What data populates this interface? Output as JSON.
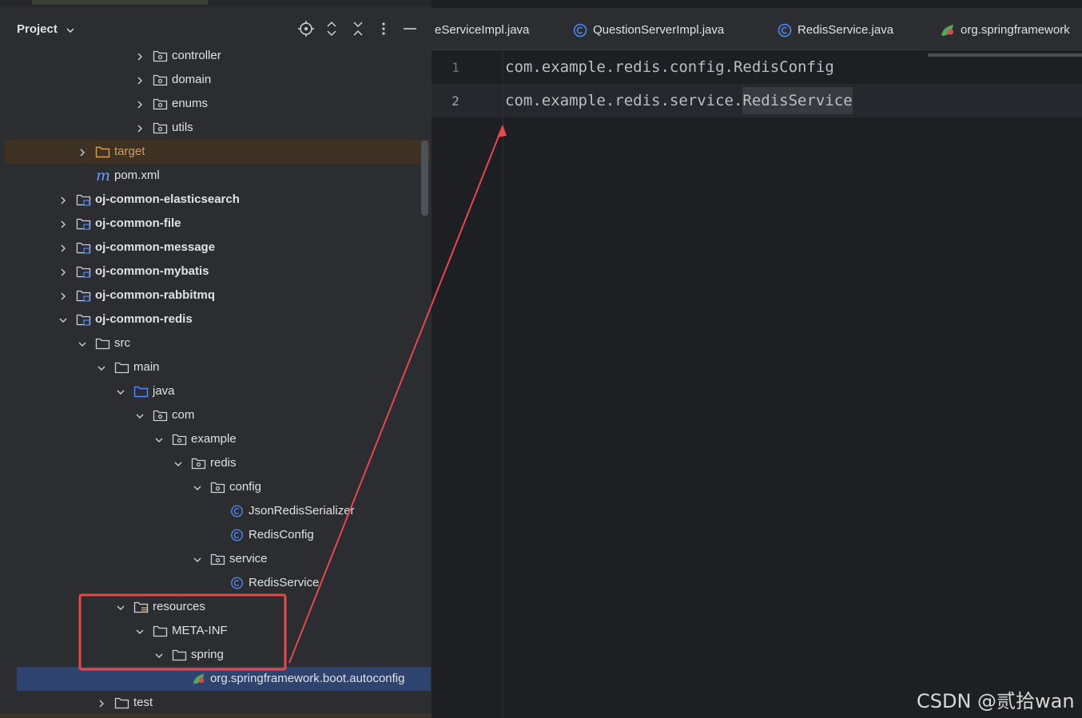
{
  "project_panel": {
    "title": "Project",
    "header_icons": [
      "locate-icon",
      "expand-collapse-icon",
      "collapse-all-icon",
      "more-options-icon",
      "minimize-icon"
    ]
  },
  "tree": [
    {
      "label": "controller",
      "depth": 4,
      "expanded": false,
      "icon": "package-folder-icon"
    },
    {
      "label": "domain",
      "depth": 4,
      "expanded": false,
      "icon": "package-folder-icon"
    },
    {
      "label": "enums",
      "depth": 4,
      "expanded": false,
      "icon": "package-folder-icon"
    },
    {
      "label": "utils",
      "depth": 4,
      "expanded": false,
      "icon": "package-folder-icon"
    },
    {
      "label": "target",
      "depth": 1,
      "expanded": false,
      "icon": "excluded-folder-icon",
      "style": "target"
    },
    {
      "label": "pom.xml",
      "depth": 1,
      "icon": "maven-icon"
    },
    {
      "label": "oj-common-elasticsearch",
      "depth": 0,
      "expanded": false,
      "icon": "module-folder-icon",
      "bold": true
    },
    {
      "label": "oj-common-file",
      "depth": 0,
      "expanded": false,
      "icon": "module-folder-icon",
      "bold": true
    },
    {
      "label": "oj-common-message",
      "depth": 0,
      "expanded": false,
      "icon": "module-folder-icon",
      "bold": true
    },
    {
      "label": "oj-common-mybatis",
      "depth": 0,
      "expanded": false,
      "icon": "module-folder-icon",
      "bold": true
    },
    {
      "label": "oj-common-rabbitmq",
      "depth": 0,
      "expanded": false,
      "icon": "module-folder-icon",
      "bold": true
    },
    {
      "label": "oj-common-redis",
      "depth": 0,
      "expanded": true,
      "icon": "module-folder-icon",
      "bold": true
    },
    {
      "label": "src",
      "depth": 1,
      "expanded": true,
      "icon": "folder-icon"
    },
    {
      "label": "main",
      "depth": 2,
      "expanded": true,
      "icon": "folder-icon"
    },
    {
      "label": "java",
      "depth": 3,
      "expanded": true,
      "icon": "source-folder-icon"
    },
    {
      "label": "com",
      "depth": 4,
      "expanded": true,
      "icon": "package-folder-icon"
    },
    {
      "label": "example",
      "depth": 5,
      "expanded": true,
      "icon": "package-folder-icon"
    },
    {
      "label": "redis",
      "depth": 6,
      "expanded": true,
      "icon": "package-folder-icon"
    },
    {
      "label": "config",
      "depth": 7,
      "expanded": true,
      "icon": "package-folder-icon"
    },
    {
      "label": "JsonRedisSerializer",
      "depth": 8,
      "icon": "class-icon"
    },
    {
      "label": "RedisConfig",
      "depth": 8,
      "icon": "class-icon"
    },
    {
      "label": "service",
      "depth": 7,
      "expanded": true,
      "icon": "package-folder-icon"
    },
    {
      "label": "RedisService",
      "depth": 8,
      "icon": "class-icon"
    },
    {
      "label": "resources",
      "depth": 3,
      "expanded": true,
      "icon": "resources-folder-icon"
    },
    {
      "label": "META-INF",
      "depth": 4,
      "expanded": true,
      "icon": "folder-icon"
    },
    {
      "label": "spring",
      "depth": 5,
      "expanded": true,
      "icon": "folder-icon"
    },
    {
      "label": "org.springframework.boot.autoconfig",
      "depth": 6,
      "icon": "spring-file-icon",
      "selected": true
    },
    {
      "label": "test",
      "depth": 2,
      "expanded": false,
      "icon": "folder-icon"
    }
  ],
  "tabs": [
    {
      "label": "eServiceImpl.java",
      "icon": "none"
    },
    {
      "label": "QuestionServerImpl.java",
      "icon": "class-icon"
    },
    {
      "label": "RedisService.java",
      "icon": "class-icon"
    },
    {
      "label": "org.springframework",
      "icon": "spring-file-icon",
      "active": true
    }
  ],
  "editor": {
    "lines": [
      {
        "number": "1",
        "text": "com.example.redis.config.RedisConfig"
      },
      {
        "number": "2",
        "prefix": "com.example.redis.service.",
        "selected": "RedisService",
        "current": true
      }
    ]
  },
  "annotation": {
    "highlight_box": "red-rectangle",
    "arrow": "red-arrow",
    "color": "#e5484d"
  },
  "watermark": "CSDN @贰拾wan",
  "colors": {
    "panel_bg": "#2b2d30",
    "editor_bg": "#1e1f22",
    "text": "#dfe1e5",
    "target_text": "#d49d5f",
    "class_icon": "#548af7",
    "selection": "#2e436e"
  }
}
